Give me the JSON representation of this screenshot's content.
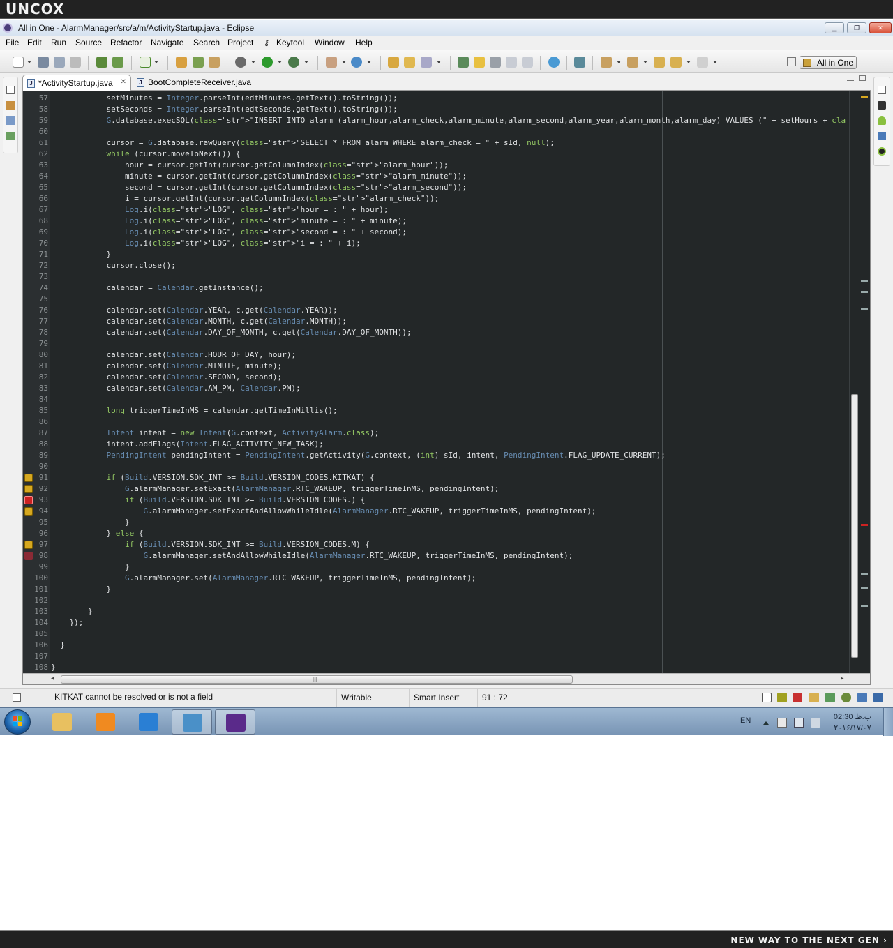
{
  "watermark": {
    "top": "UNCOX",
    "bottom": "NEW WAY TO THE NEXT GEN ›"
  },
  "window": {
    "title": "All in One - AlarmManager/src/a/m/ActivityStartup.java - Eclipse",
    "controls": {
      "minimize": "▁",
      "maximize": "❐",
      "close": "✕"
    }
  },
  "menu": [
    "File",
    "Edit",
    "Run",
    "Source",
    "Refactor",
    "Navigate",
    "Search",
    "Project",
    "Keytool",
    "Window",
    "Help"
  ],
  "perspective": {
    "label": "All in One",
    "icon": "java-ee-perspective-icon"
  },
  "tabs": [
    {
      "label": "*ActivityStartup.java",
      "active": true,
      "icon": "java-file-icon"
    },
    {
      "label": "BootCompleteReceiver.java",
      "active": false,
      "icon": "java-file-icon"
    }
  ],
  "editor": {
    "lines": [
      {
        "n": "57",
        "t": "            setMinutes = Integer.parseInt(edtMinutes.getText().toString());"
      },
      {
        "n": "58",
        "t": "            setSeconds = Integer.parseInt(edtSeconds.getText().toString());"
      },
      {
        "n": "59",
        "t": "            G.database.execSQL(\"INSERT INTO alarm (alarm_hour,alarm_check,alarm_minute,alarm_second,alarm_year,alarm_month,alarm_day) VALUES (\" + setHours + \",\""
      },
      {
        "n": "60",
        "t": ""
      },
      {
        "n": "61",
        "t": "            cursor = G.database.rawQuery(\"SELECT * FROM alarm WHERE alarm_check = \" + sId, null);"
      },
      {
        "n": "62",
        "t": "            while (cursor.moveToNext()) {"
      },
      {
        "n": "63",
        "t": "                hour = cursor.getInt(cursor.getColumnIndex(\"alarm_hour\"));"
      },
      {
        "n": "64",
        "t": "                minute = cursor.getInt(cursor.getColumnIndex(\"alarm_minute\"));"
      },
      {
        "n": "65",
        "t": "                second = cursor.getInt(cursor.getColumnIndex(\"alarm_second\"));"
      },
      {
        "n": "66",
        "t": "                i = cursor.getInt(cursor.getColumnIndex(\"alarm_check\"));"
      },
      {
        "n": "67",
        "t": "                Log.i(\"LOG\", \"hour = : \" + hour);"
      },
      {
        "n": "68",
        "t": "                Log.i(\"LOG\", \"minute = : \" + minute);"
      },
      {
        "n": "69",
        "t": "                Log.i(\"LOG\", \"second = : \" + second);"
      },
      {
        "n": "70",
        "t": "                Log.i(\"LOG\", \"i = : \" + i);"
      },
      {
        "n": "71",
        "t": "            }"
      },
      {
        "n": "72",
        "t": "            cursor.close();"
      },
      {
        "n": "73",
        "t": ""
      },
      {
        "n": "74",
        "t": "            calendar = Calendar.getInstance();"
      },
      {
        "n": "75",
        "t": ""
      },
      {
        "n": "76",
        "t": "            calendar.set(Calendar.YEAR, c.get(Calendar.YEAR));"
      },
      {
        "n": "77",
        "t": "            calendar.set(Calendar.MONTH, c.get(Calendar.MONTH));"
      },
      {
        "n": "78",
        "t": "            calendar.set(Calendar.DAY_OF_MONTH, c.get(Calendar.DAY_OF_MONTH));"
      },
      {
        "n": "79",
        "t": ""
      },
      {
        "n": "80",
        "t": "            calendar.set(Calendar.HOUR_OF_DAY, hour);"
      },
      {
        "n": "81",
        "t": "            calendar.set(Calendar.MINUTE, minute);"
      },
      {
        "n": "82",
        "t": "            calendar.set(Calendar.SECOND, second);"
      },
      {
        "n": "83",
        "t": "            calendar.set(Calendar.AM_PM, Calendar.PM);"
      },
      {
        "n": "84",
        "t": ""
      },
      {
        "n": "85",
        "t": "            long triggerTimeInMS = calendar.getTimeInMillis();"
      },
      {
        "n": "86",
        "t": ""
      },
      {
        "n": "87",
        "t": "            Intent intent = new Intent(G.context, ActivityAlarm.class);"
      },
      {
        "n": "88",
        "t": "            intent.addFlags(Intent.FLAG_ACTIVITY_NEW_TASK);"
      },
      {
        "n": "89",
        "t": "            PendingIntent pendingIntent = PendingIntent.getActivity(G.context, (int) sId, intent, PendingIntent.FLAG_UPDATE_CURRENT);"
      },
      {
        "n": "90",
        "t": ""
      },
      {
        "n": "91",
        "t": "            if (Build.VERSION.SDK_INT >= Build.VERSION_CODES.KITKAT) {",
        "mark": "warn"
      },
      {
        "n": "92",
        "t": "                G.alarmManager.setExact(AlarmManager.RTC_WAKEUP, triggerTimeInMS, pendingIntent);",
        "mark": "warn"
      },
      {
        "n": "93",
        "t": "                if (Build.VERSION.SDK_INT >= Build.VERSION_CODES.) {",
        "mark": "err"
      },
      {
        "n": "94",
        "t": "                    G.alarmManager.setExactAndAllowWhileIdle(AlarmManager.RTC_WAKEUP, triggerTimeInMS, pendingIntent);",
        "mark": "warn"
      },
      {
        "n": "95",
        "t": "                }"
      },
      {
        "n": "96",
        "t": "            } else {"
      },
      {
        "n": "97",
        "t": "                if (Build.VERSION.SDK_INT >= Build.VERSION_CODES.M) {",
        "mark": "warn"
      },
      {
        "n": "98",
        "t": "                    G.alarmManager.setAndAllowWhileIdle(AlarmManager.RTC_WAKEUP, triggerTimeInMS, pendingIntent);",
        "mark": "errhl"
      },
      {
        "n": "99",
        "t": "                }"
      },
      {
        "n": "100",
        "t": "                G.alarmManager.set(AlarmManager.RTC_WAKEUP, triggerTimeInMS, pendingIntent);"
      },
      {
        "n": "101",
        "t": "            }"
      },
      {
        "n": "102",
        "t": ""
      },
      {
        "n": "103",
        "t": "        }"
      },
      {
        "n": "104",
        "t": "    });"
      },
      {
        "n": "105",
        "t": ""
      },
      {
        "n": "106",
        "t": "  }"
      },
      {
        "n": "107",
        "t": ""
      },
      {
        "n": "108",
        "t": "}"
      }
    ]
  },
  "status": {
    "message": "KITKAT cannot be resolved or is not a field",
    "writable": "Writable",
    "insert_mode": "Smart Insert",
    "position": "91 : 72"
  },
  "taskbar": {
    "apps": [
      {
        "name": "explorer-app",
        "color": "#e8c060"
      },
      {
        "name": "media-player-app",
        "color": "#f08a20"
      },
      {
        "name": "internet-explorer-app",
        "color": "#2a7fd4"
      },
      {
        "name": "chrome-app",
        "color": "#4a90c8"
      },
      {
        "name": "java-ee-ide-app",
        "color": "#5a2a8a"
      }
    ],
    "language": "EN",
    "time": "02:30 ب.ظ",
    "date": "۲۰۱۶/۱۷/۰۷"
  },
  "colors": {
    "editor_bg": "#232728",
    "keyword": "#93c763",
    "field": "#678cb1",
    "string": "#ec7600",
    "text": "#e0e2e4",
    "accent_title": "#d6e2f0"
  }
}
